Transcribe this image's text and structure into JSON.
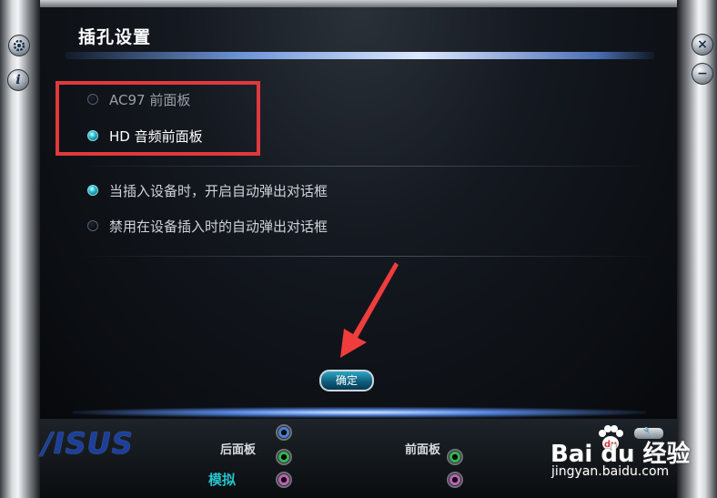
{
  "window": {
    "title": "插孔设置"
  },
  "side_buttons": {
    "settings_icon": "gear-icon",
    "info_icon": "info-icon",
    "info_glyph": "i",
    "close_icon": "close-icon",
    "close_glyph": "×",
    "minimize_icon": "minimize-icon",
    "minimize_glyph": "−"
  },
  "front_panel_type": {
    "options": [
      {
        "label": "AC97 前面板",
        "selected": false
      },
      {
        "label": "HD 音频前面板",
        "selected": true
      }
    ]
  },
  "dialog_behavior": {
    "options": [
      {
        "label": "当插入设备时，开启自动弹出对话框",
        "selected": true
      },
      {
        "label": "禁用在设备插入时的自动弹出对话框",
        "selected": false
      }
    ]
  },
  "ok_button": {
    "label": "确定"
  },
  "bottom_bar": {
    "brand": "/ISUS",
    "rear_panel_label": "后面板",
    "front_panel_label": "前面板",
    "mode_label": "模拟",
    "tool_glyph": "🔧"
  },
  "watermark": {
    "text": "Bai du 经验",
    "url": "jingyan.baidu.com"
  },
  "colors": {
    "highlight_box": "#e0393c",
    "accent_cyan": "#26c2c9",
    "jack_blue": "#4a7fd1",
    "jack_green": "#36b24a",
    "jack_pink": "#c25fb4"
  }
}
